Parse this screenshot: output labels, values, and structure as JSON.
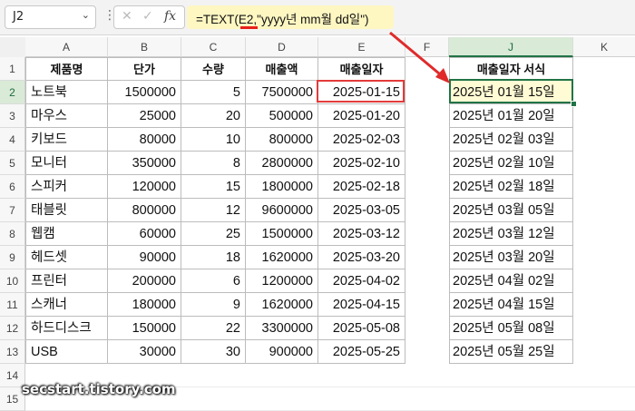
{
  "formula_bar": {
    "name_box": "J2",
    "formula_prefix": "=TEXT(",
    "formula_ref": "E2",
    "formula_rest": ",\"yyyy년 mm월 dd일\")",
    "icons": [
      "cancel-icon",
      "enter-icon",
      "function-icon"
    ],
    "cancel_glyph": "✕",
    "enter_glyph": "✓",
    "fx_glyph": "fx"
  },
  "column_headers": [
    "A",
    "B",
    "C",
    "D",
    "E",
    "F",
    "J",
    "K"
  ],
  "row_headers": [
    "1",
    "2",
    "3",
    "4",
    "5",
    "6",
    "7",
    "8",
    "9",
    "10",
    "11",
    "12",
    "13",
    "14",
    "15"
  ],
  "table": {
    "headers": [
      "제품명",
      "단가",
      "수량",
      "매출액",
      "매출일자"
    ],
    "rows": [
      [
        "노트북",
        "1500000",
        "5",
        "7500000",
        "2025-01-15"
      ],
      [
        "마우스",
        "25000",
        "20",
        "500000",
        "2025-01-20"
      ],
      [
        "키보드",
        "80000",
        "10",
        "800000",
        "2025-02-03"
      ],
      [
        "모니터",
        "350000",
        "8",
        "2800000",
        "2025-02-10"
      ],
      [
        "스피커",
        "120000",
        "15",
        "1800000",
        "2025-02-18"
      ],
      [
        "태블릿",
        "800000",
        "12",
        "9600000",
        "2025-03-05"
      ],
      [
        "웹캠",
        "60000",
        "25",
        "1500000",
        "2025-03-12"
      ],
      [
        "헤드셋",
        "90000",
        "18",
        "1620000",
        "2025-03-20"
      ],
      [
        "프린터",
        "200000",
        "6",
        "1200000",
        "2025-04-02"
      ],
      [
        "스캐너",
        "180000",
        "9",
        "1620000",
        "2025-04-15"
      ],
      [
        "하드디스크",
        "150000",
        "22",
        "3300000",
        "2025-05-08"
      ],
      [
        "USB",
        "30000",
        "30",
        "900000",
        "2025-05-25"
      ]
    ]
  },
  "result_column": {
    "header": "매출일자 서식",
    "values": [
      "2025년 01월 15일",
      "2025년 01월 20일",
      "2025년 02월 03일",
      "2025년 02월 10일",
      "2025년 02월 18일",
      "2025년 03월 05일",
      "2025년 03월 12일",
      "2025년 03월 20일",
      "2025년 04월 02일",
      "2025년 04월 15일",
      "2025년 05월 08일",
      "2025년 05월 25일"
    ]
  },
  "watermark": "secstart.tistory.com",
  "colors": {
    "highlight_red": "#e33b3b",
    "selection_green": "#217346",
    "formula_bg": "#fff7c2",
    "arrow_red": "#e02a2a"
  }
}
